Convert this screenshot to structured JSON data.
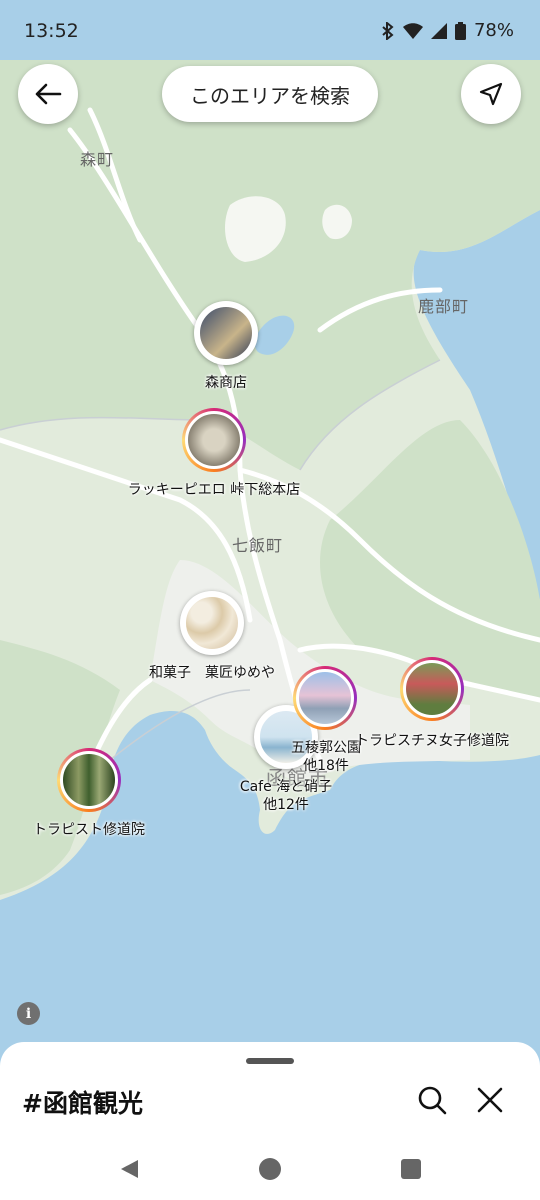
{
  "status_bar": {
    "time": "13:52",
    "battery": "78%"
  },
  "top_bar": {
    "search_area_label": "このエリアを検索"
  },
  "map": {
    "towns": [
      "森町",
      "鹿部町",
      "七飯町",
      "函館市"
    ]
  },
  "pins": [
    {
      "label": "森商店",
      "ring": false,
      "photo_colors": [
        "#3b4b6b",
        "#c8b48a"
      ]
    },
    {
      "label": "ラッキーピエロ 峠下総本店",
      "ring": true,
      "photo_colors": [
        "#b7b0a0",
        "#6f6a60"
      ]
    },
    {
      "label": "和菓子　菓匠ゆめや",
      "ring": false,
      "photo_colors": [
        "#ede4d2",
        "#d9c7a7"
      ]
    },
    {
      "label": "五稜郭公園",
      "extra": "他18件",
      "ring": true,
      "photo_colors": [
        "#9ec0e8",
        "#e6c3d6"
      ]
    },
    {
      "label": "トラピスチヌ女子修道院",
      "ring": true,
      "photo_colors": [
        "#5f7d3f",
        "#c85a5a"
      ]
    },
    {
      "label": "Cafe 海と硝子",
      "extra": "他12件",
      "ring": false,
      "photo_colors": [
        "#cfe3ef",
        "#8ab4cf"
      ]
    },
    {
      "label": "トラピスト修道院",
      "ring": true,
      "photo_colors": [
        "#3f5f2e",
        "#8c9a63"
      ]
    }
  ],
  "sheet": {
    "hashtag": "#函館観光"
  },
  "colors": {
    "sea": "#a8cfe8",
    "land": "#e4ede0",
    "forest": "#cfe0c9",
    "road": "#ffffff"
  }
}
